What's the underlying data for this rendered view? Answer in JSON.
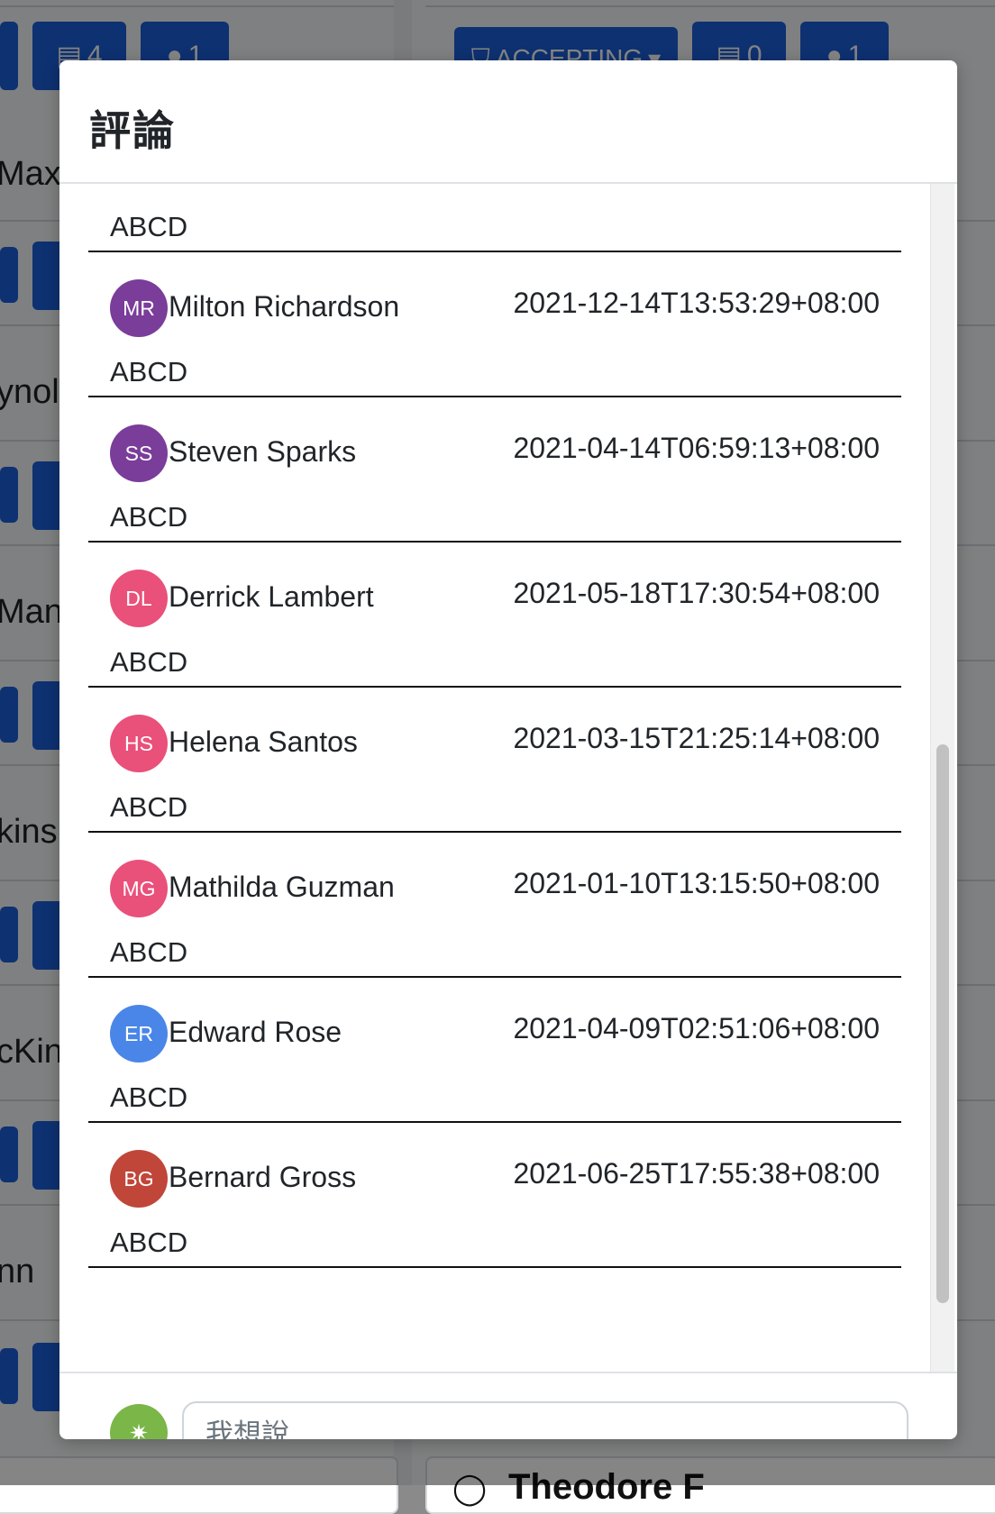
{
  "background": {
    "names": [
      "Max",
      "ynol",
      "Mann",
      "kins",
      "cKin",
      "nn"
    ],
    "buttons": {
      "comments_count_left": "4",
      "viewers_count_left": "1",
      "status_filter": "ACCEPTING",
      "comments_count_right": "0",
      "viewers_count_right": "1"
    },
    "card_title": "Theodore F"
  },
  "modal": {
    "title": "評論",
    "comments": [
      {
        "initials": "",
        "name": "",
        "timestamp": "",
        "text": "ABCD",
        "color": "#c0463a"
      },
      {
        "initials": "MR",
        "name": "Milton Richardson",
        "timestamp": "2021-12-14T13:53:29+08:00",
        "text": "ABCD",
        "color": "#7a3d9a"
      },
      {
        "initials": "SS",
        "name": "Steven Sparks",
        "timestamp": "2021-04-14T06:59:13+08:00",
        "text": "ABCD",
        "color": "#7a3d9a"
      },
      {
        "initials": "DL",
        "name": "Derrick Lambert",
        "timestamp": "2021-05-18T17:30:54+08:00",
        "text": "ABCD",
        "color": "#e9507a"
      },
      {
        "initials": "HS",
        "name": "Helena Santos",
        "timestamp": "2021-03-15T21:25:14+08:00",
        "text": "ABCD",
        "color": "#e9507a"
      },
      {
        "initials": "MG",
        "name": "Mathilda Guzman",
        "timestamp": "2021-01-10T13:15:50+08:00",
        "text": "ABCD",
        "color": "#e9507a"
      },
      {
        "initials": "ER",
        "name": "Edward Rose",
        "timestamp": "2021-04-09T02:51:06+08:00",
        "text": "ABCD",
        "color": "#4a86e8"
      },
      {
        "initials": "BG",
        "name": "Bernard Gross",
        "timestamp": "2021-06-25T17:55:38+08:00",
        "text": "ABCD",
        "color": "#c0463a"
      }
    ],
    "footer": {
      "avatar_glyph": "✷",
      "avatar_color": "#7ab648",
      "input_placeholder": "我想說...",
      "input_value": ""
    }
  }
}
